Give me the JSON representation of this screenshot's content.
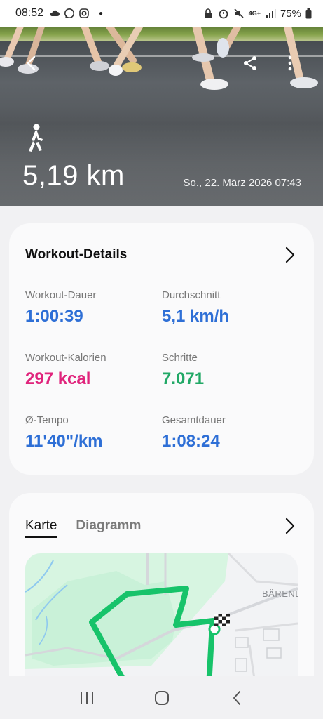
{
  "status_bar": {
    "time": "08:52",
    "battery": "75%",
    "network": "4G+"
  },
  "hero": {
    "distance": "5,19 km",
    "date": "So., 22. März 2026 07:43",
    "activity_icon": "walk-icon"
  },
  "workout": {
    "title": "Workout-Details",
    "metrics": [
      {
        "label": "Workout-Dauer",
        "value": "1:00:39",
        "color": "#2e6fd6"
      },
      {
        "label": "Durchschnitt",
        "value": "5,1 km/h",
        "color": "#2e6fd6"
      },
      {
        "label": "Workout-Kalorien",
        "value": "297 kcal",
        "color": "#e0247c"
      },
      {
        "label": "Schritte",
        "value": "7.071",
        "color": "#21a866"
      },
      {
        "label": "Ø-Tempo",
        "value": "11'40\"/km",
        "color": "#2e6fd6"
      },
      {
        "label": "Gesamtdauer",
        "value": "1:08:24",
        "color": "#2e6fd6"
      }
    ]
  },
  "map_card": {
    "tabs": [
      {
        "label": "Karte",
        "active": true
      },
      {
        "label": "Diagramm",
        "active": false
      }
    ],
    "map_label": "BÄREND"
  },
  "colors": {
    "accent_blue": "#2e6fd6",
    "accent_pink": "#e0247c",
    "accent_green": "#21a866",
    "route_green": "#17c36a"
  }
}
